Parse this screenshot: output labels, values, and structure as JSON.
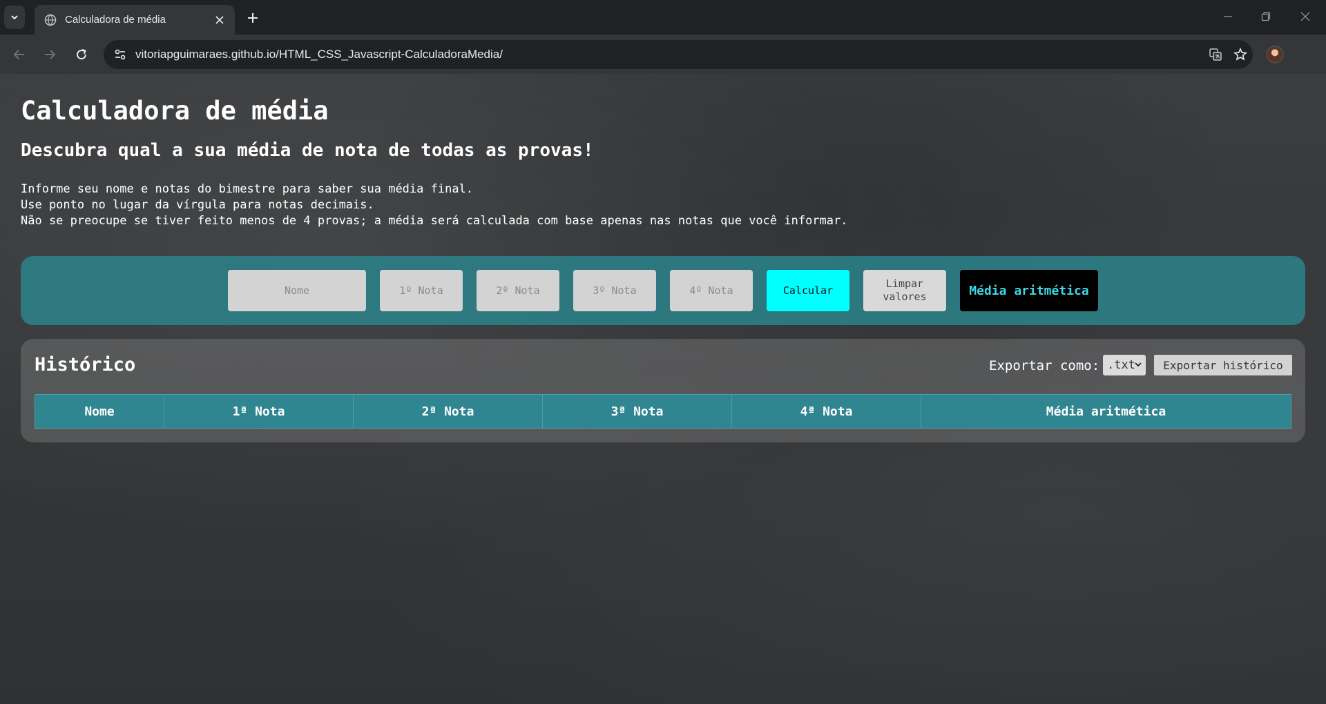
{
  "browser": {
    "tab_title": "Calculadora de média",
    "url": "vitoriapguimaraes.github.io/HTML_CSS_Javascript-CalculadoraMedia/"
  },
  "page": {
    "heading": "Calculadora de média",
    "subheading": "Descubra qual a sua média de nota de todas as provas!",
    "intro_lines": [
      "Informe seu nome e notas do bimestre para saber sua média final.",
      "Use ponto no lugar da vírgula para notas decimais.",
      "Não se preocupe se tiver feito menos de 4 provas; a média será calculada com base apenas nas notas que você informar."
    ]
  },
  "calculator": {
    "name_placeholder": "Nome",
    "grade_placeholders": [
      "1º Nota",
      "2º Nota",
      "3º Nota",
      "4º Nota"
    ],
    "calculate_label": "Calcular",
    "clear_label_line1": "Limpar",
    "clear_label_line2": "valores",
    "result_label": "Média aritmética",
    "colors": {
      "panel": "#2c828b",
      "calculate_button": "#00ffff",
      "result_text": "#3fd7e6"
    }
  },
  "history": {
    "title": "Histórico",
    "export_label": "Exportar como:",
    "export_format": ".txt",
    "export_button": "Exportar histórico",
    "columns": [
      "Nome",
      "1ª Nota",
      "2ª Nota",
      "3ª Nota",
      "4ª Nota",
      "Média aritmética"
    ],
    "rows": []
  }
}
